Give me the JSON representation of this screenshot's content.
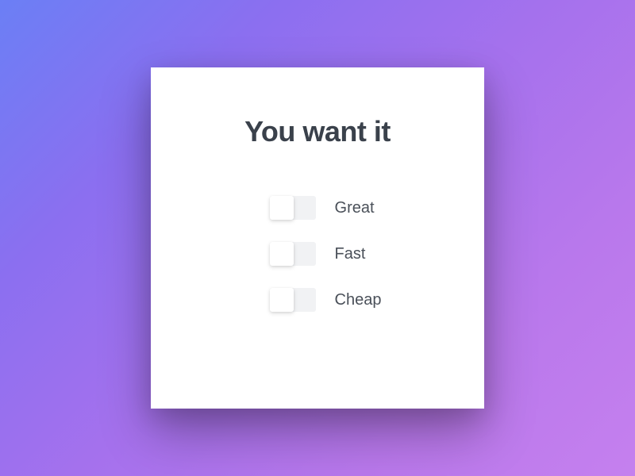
{
  "card": {
    "title": "You want it",
    "options": [
      {
        "label": "Great",
        "checked": false
      },
      {
        "label": "Fast",
        "checked": false
      },
      {
        "label": "Cheap",
        "checked": false
      }
    ]
  }
}
